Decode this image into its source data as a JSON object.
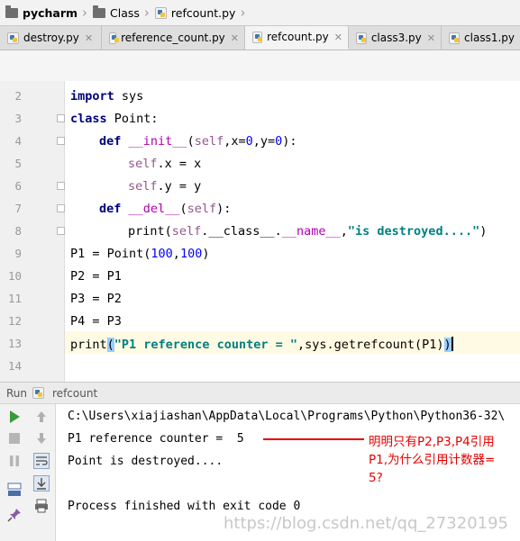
{
  "breadcrumb": {
    "project": "pycharm",
    "folder": "Class",
    "file": "refcount.py"
  },
  "tabs": [
    {
      "label": "destroy.py",
      "active": false
    },
    {
      "label": "reference_count.py",
      "active": false
    },
    {
      "label": "refcount.py",
      "active": true
    },
    {
      "label": "class3.py",
      "active": false
    },
    {
      "label": "class1.py",
      "active": false
    }
  ],
  "editor": {
    "line_numbers": [
      "2",
      "3",
      "4",
      "5",
      "6",
      "7",
      "8",
      "9",
      "10",
      "11",
      "12",
      "13",
      "14"
    ],
    "current_line": "13",
    "code": {
      "l2": {
        "kw": "import",
        "rest": " sys"
      },
      "l3": {
        "kw": "class",
        "rest": " Point:"
      },
      "l4": {
        "kw": "def",
        "fn": "__init__",
        "p1": "(",
        "self": "self",
        "p2": ",x=",
        "n1": "0",
        "p3": ",y=",
        "n2": "0",
        "p4": "):"
      },
      "l5": {
        "self": "self",
        "rest": ".x = x"
      },
      "l6": {
        "self": "self",
        "rest": ".y = y"
      },
      "l7": {
        "kw": "def",
        "fn": "__del__",
        "p1": "(",
        "self": "self",
        "p2": "):"
      },
      "l8": {
        "a": "print(",
        "self": "self",
        "b": ".",
        "c": "__class__",
        "d": ".",
        "e": "__name__",
        "f": ",",
        "str": "\"is destroyed....\"",
        "g": ")"
      },
      "l9": {
        "a": "P1 = Point(",
        "n1": "100",
        "b": ",",
        "n2": "100",
        "c": ")"
      },
      "l10": "P2 = P1",
      "l11": "P3 = P2",
      "l12": "P4 = P3",
      "l13": {
        "a": "print",
        "b": "(",
        "str": "\"P1 reference counter = \"",
        "c": ",sys.getrefcount(P1)",
        "d": ")"
      }
    }
  },
  "run_panel": {
    "label": "Run",
    "config": "refcount",
    "console": [
      "C:\\Users\\xiajiashan\\AppData\\Local\\Programs\\Python\\Python36-32\\",
      "P1 reference counter =  5",
      "Point is destroyed....",
      "",
      "Process finished with exit code 0"
    ]
  },
  "annotation": {
    "text_line1": "明明只有P2,P3,P4引用",
    "text_line2": "P1,为什么引用计数器=",
    "text_line3": "5?",
    "color": "#e60000"
  },
  "watermark": "https://blog.csdn.net/qq_27320195",
  "icons": [
    "folder-icon",
    "python-file-icon",
    "close-icon",
    "run-icon",
    "stop-icon",
    "pause-icon",
    "up-arrow-icon",
    "down-arrow-icon",
    "soft-wrap-icon",
    "scroll-to-end-icon",
    "layout-icon",
    "print-icon",
    "pin-icon"
  ]
}
